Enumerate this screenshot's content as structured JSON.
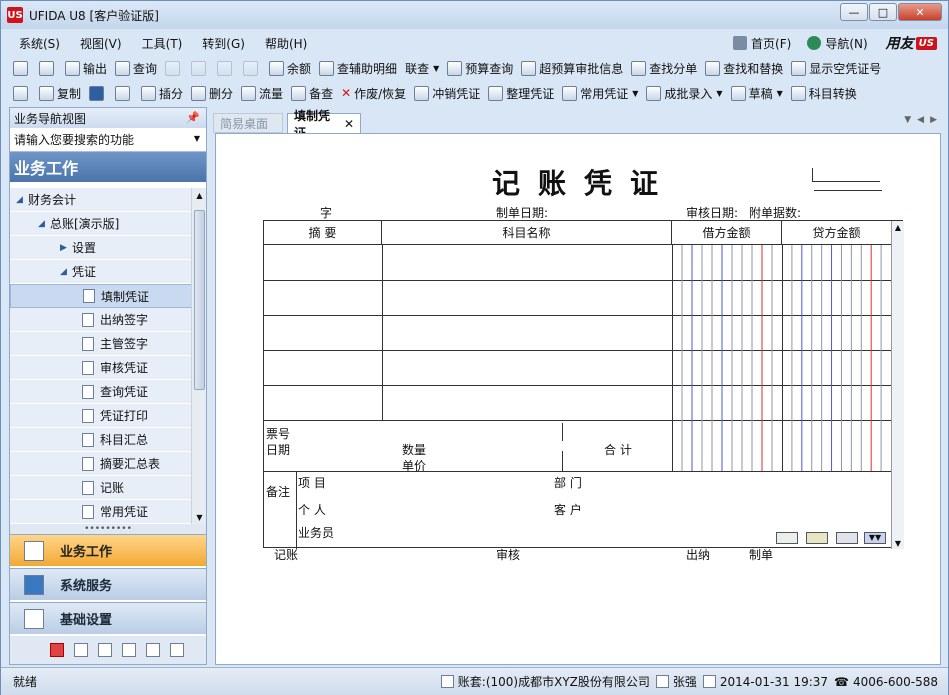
{
  "window": {
    "title": "UFIDA U8 [客户验证版]",
    "logo": "US"
  },
  "menu": {
    "items": [
      "系统(S)",
      "视图(V)",
      "工具(T)",
      "转到(G)",
      "帮助(H)"
    ],
    "home": "首页(F)",
    "nav": "导航(N)",
    "brand": "用友",
    "brand_box": "US"
  },
  "toolbar1": [
    "输出",
    "查询",
    "余额",
    "查辅助明细",
    "联查",
    "预算查询",
    "超预算审批信息",
    "查找分单",
    "查找和替换",
    "显示空凭证号"
  ],
  "toolbar2": [
    "复制",
    "插分",
    "删分",
    "流量",
    "备查",
    "作废/恢复",
    "冲销凭证",
    "整理凭证",
    "常用凭证",
    "成批录入",
    "草稿",
    "科目转换"
  ],
  "leftpane": {
    "header": "业务导航视图",
    "search_placeholder": "请输入您要搜索的功能",
    "section": "业务工作",
    "tree": [
      {
        "label": "财务会计",
        "level": 0,
        "type": "open"
      },
      {
        "label": "总账[演示版]",
        "level": 1,
        "type": "open"
      },
      {
        "label": "设置",
        "level": 2,
        "type": "closed"
      },
      {
        "label": "凭证",
        "level": 2,
        "type": "open"
      },
      {
        "label": "填制凭证",
        "level": 3,
        "type": "leaf",
        "selected": true
      },
      {
        "label": "出纳签字",
        "level": 3,
        "type": "leaf"
      },
      {
        "label": "主管签字",
        "level": 3,
        "type": "leaf"
      },
      {
        "label": "审核凭证",
        "level": 3,
        "type": "leaf"
      },
      {
        "label": "查询凭证",
        "level": 3,
        "type": "leaf"
      },
      {
        "label": "凭证打印",
        "level": 3,
        "type": "leaf"
      },
      {
        "label": "科目汇总",
        "level": 3,
        "type": "leaf"
      },
      {
        "label": "摘要汇总表",
        "level": 3,
        "type": "leaf"
      },
      {
        "label": "记账",
        "level": 3,
        "type": "leaf"
      },
      {
        "label": "常用凭证",
        "level": 3,
        "type": "leaf"
      }
    ],
    "nav_buttons": [
      "业务工作",
      "系统服务",
      "基础设置"
    ]
  },
  "tabs": {
    "inactive": "简易桌面",
    "active": "填制凭证"
  },
  "voucher": {
    "title": "记账凭证",
    "zi": "字",
    "make_date": "制单日期:",
    "audit_date": "审核日期:",
    "attach": "附单据数:",
    "col_summary": "摘 要",
    "col_account": "科目名称",
    "col_debit": "借方金额",
    "col_credit": "贷方金额",
    "ticket_no": "票号",
    "date": "日期",
    "quantity": "数量",
    "unit_price": "单价",
    "total": "合 计",
    "remark": "备注",
    "project": "项 目",
    "dept": "部 门",
    "person": "个 人",
    "customer": "客 户",
    "salesman": "业务员",
    "sign_book": "记账",
    "sign_audit": "审核",
    "sign_cashier": "出纳",
    "sign_maker": "制单"
  },
  "status": {
    "left": "就绪",
    "account": "账套:(100)成都市XYZ股份有限公司",
    "user": "张强",
    "datetime": "2014-01-31 19:37",
    "phone": "4006-600-588"
  }
}
